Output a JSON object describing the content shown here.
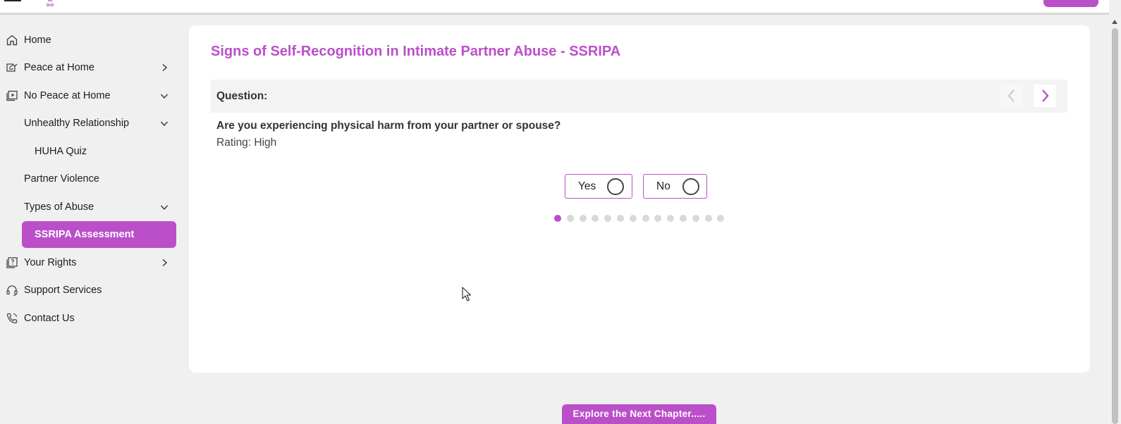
{
  "header": {
    "logo_icon": "app-logo-icon",
    "menu_icon": "hamburger-menu-icon"
  },
  "sidebar": {
    "items": [
      {
        "label": "Home",
        "icon": "home-icon"
      },
      {
        "label": "Peace at Home",
        "icon": "book-icon",
        "chevron": "chevron-right-icon"
      },
      {
        "label": "No Peace at Home",
        "icon": "video-play-icon",
        "chevron": "chevron-down-icon"
      },
      {
        "label": "Unhealthy Relationship",
        "chevron": "chevron-down-icon"
      },
      {
        "label": "HUHA Quiz"
      },
      {
        "label": "Partner Violence"
      },
      {
        "label": "Types of Abuse",
        "chevron": "chevron-down-icon"
      },
      {
        "label": "SSRIPA Assessment",
        "active": true
      },
      {
        "label": "Your Rights",
        "icon": "question-book-icon",
        "chevron": "chevron-right-icon"
      },
      {
        "label": "Support Services",
        "icon": "headset-icon"
      },
      {
        "label": "Contact Us",
        "icon": "phone-icon"
      }
    ]
  },
  "main": {
    "title": "Signs of Self-Recognition in Intimate Partner Abuse - SSRIPA",
    "question_label": "Question:",
    "question_text": "Are you experiencing physical harm from your partner or spouse?",
    "rating": "Rating: High",
    "answers": {
      "yes": "Yes",
      "no": "No"
    },
    "progress": {
      "total_questions": 14,
      "current_question": 1
    }
  },
  "footer": {
    "explore_label": "Explore the Next Chapter....."
  },
  "colors": {
    "accent": "#bb4fc9",
    "background": "#f0f0f0",
    "card": "#ffffff",
    "dot_inactive": "#d9d9d9"
  }
}
